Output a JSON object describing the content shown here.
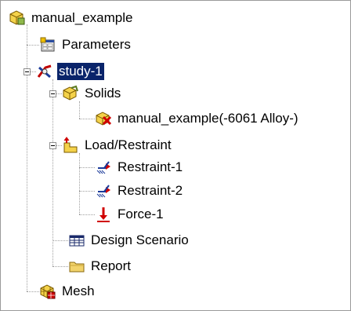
{
  "tree": {
    "root": {
      "label": "manual_example",
      "icon": "part-assembly-icon"
    },
    "parameters": {
      "label": "Parameters",
      "icon": "parameters-icon"
    },
    "study": {
      "label": "study-1",
      "icon": "study-icon",
      "selected": true
    },
    "solids": {
      "label": "Solids",
      "icon": "solids-icon"
    },
    "solid_item": {
      "label": "manual_example(-6061 Alloy-)",
      "icon": "solid-body-icon"
    },
    "load_restraint": {
      "label": "Load/Restraint",
      "icon": "load-restraint-icon"
    },
    "restraint1": {
      "label": "Restraint-1",
      "icon": "restraint-icon"
    },
    "restraint2": {
      "label": "Restraint-2",
      "icon": "restraint-icon"
    },
    "force1": {
      "label": "Force-1",
      "icon": "force-arrow-icon"
    },
    "design_scenario": {
      "label": "Design Scenario",
      "icon": "design-scenario-table-icon"
    },
    "report": {
      "label": "Report",
      "icon": "report-folder-icon"
    },
    "mesh": {
      "label": "Mesh",
      "icon": "mesh-icon"
    }
  },
  "colors": {
    "selection": "#0a246a",
    "selection_text": "#ffffff"
  }
}
